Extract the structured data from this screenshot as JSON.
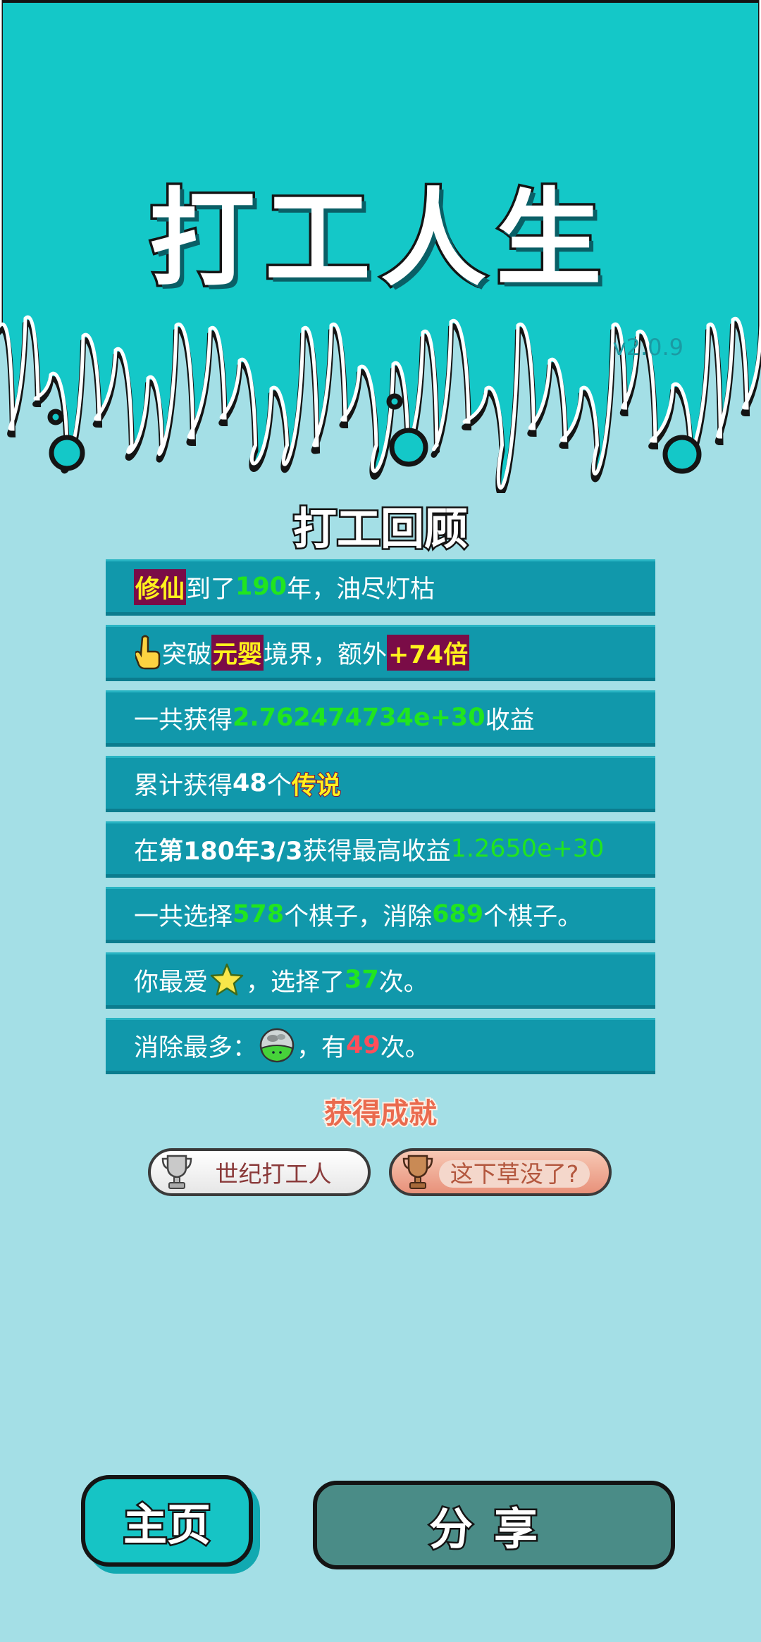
{
  "game": {
    "title": "打工人生",
    "version": "v2.0.9"
  },
  "review": {
    "title": "打工回顾",
    "rows": [
      {
        "parts": [
          "修仙",
          "到了",
          "190",
          "年，油尽灯枯"
        ]
      },
      {
        "parts": [
          "突破",
          "元婴",
          "境界，额外",
          "+74倍"
        ]
      },
      {
        "parts": [
          "一共获得",
          "2.762474734e+30",
          "收益"
        ]
      },
      {
        "parts": [
          "累计获得",
          "48",
          "个",
          "传说"
        ]
      },
      {
        "parts": [
          "在 ",
          "第180年3/3",
          " 获得最高收益",
          "1.2650e+30"
        ]
      },
      {
        "parts": [
          "一共选择",
          "578",
          "个棋子，消除",
          "689",
          "个棋子。"
        ]
      },
      {
        "parts": [
          "你最爱",
          "，选择了",
          "37",
          "次。"
        ]
      },
      {
        "parts": [
          "消除最多：",
          "，有",
          "49",
          "次。"
        ]
      }
    ]
  },
  "icons": {
    "row2": "pointing-hand-icon",
    "row7": "star-icon",
    "row8": "grass-ball-icon",
    "trophy": "trophy-icon"
  },
  "achievements": {
    "title": "获得成就",
    "items": [
      {
        "label": "世纪打工人"
      },
      {
        "label": "这下草没了?"
      }
    ]
  },
  "buttons": {
    "home": "主页",
    "share": "分享"
  },
  "colors": {
    "banner": "#14c8c8",
    "background": "#a4dfe6",
    "row": "#1198ab",
    "highlight_green": "#21e51f"
  }
}
